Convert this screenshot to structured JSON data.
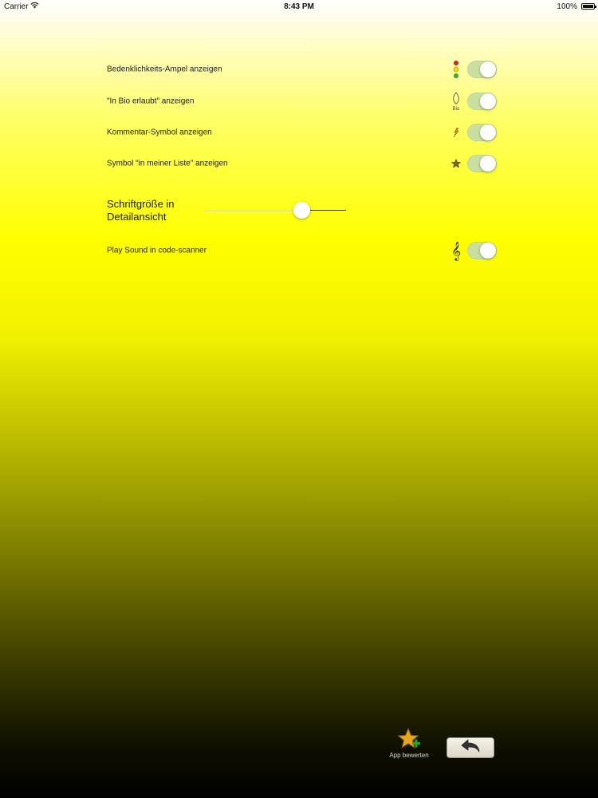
{
  "status_bar": {
    "carrier": "Carrier",
    "time": "8:43 PM",
    "battery": "100%"
  },
  "settings": {
    "rows": [
      {
        "label": "Bedenklichkeits-Ampel anzeigen",
        "icon": "traffic-light-icon",
        "toggle_on": true
      },
      {
        "label": "\"In Bio erlaubt\" anzeigen",
        "icon": "bio-leaf-icon",
        "icon_text": "Bio",
        "toggle_on": true
      },
      {
        "label": "Kommentar-Symbol anzeigen",
        "icon": "comment-star-icon",
        "toggle_on": true
      },
      {
        "label": "Symbol \"in meiner Liste\" anzeigen",
        "icon": "list-star-icon",
        "toggle_on": true
      }
    ],
    "font_size": {
      "label": "Schriftgröße in Detailansicht",
      "value": 0.7
    },
    "sound_row": {
      "label": "Play Sound in code-scanner",
      "icon": "treble-clef-icon",
      "toggle_on": true
    }
  },
  "bottom_bar": {
    "rate_label": "App bewerten",
    "rate_icon": "star-plus-icon",
    "back_icon": "back-arrow-icon"
  },
  "colors": {
    "toggle_on": "#c9e0a0",
    "background_top": "#ffffff",
    "background_mid": "#ffff00",
    "background_bottom": "#000000"
  }
}
